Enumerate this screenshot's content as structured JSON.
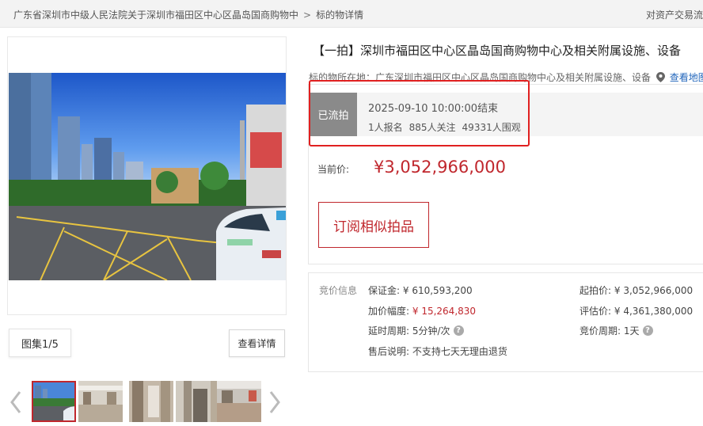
{
  "breadcrumb": {
    "item1": "广东省深圳市中级人民法院关于深圳市福田区中心区晶岛国商购物中",
    "separator": ">",
    "item2": "标的物详情"
  },
  "topbar_right": "对资产交易流",
  "gallery": {
    "counter_label": "图集1/5",
    "details_button": "查看详情",
    "thumb_count": 5
  },
  "title": "【一拍】深圳市福田区中心区晶岛国商购物中心及相关附属设施、设备",
  "location": {
    "label": "标的物所在地：",
    "value": "广东深圳市福田区中心区晶岛国商购物中心及相关附属设施、设备",
    "map_link": "查看地图"
  },
  "status": {
    "badge": "已流拍",
    "end_time": "2025-09-10 10:00:00结束",
    "registrations": "1人报名",
    "followers": "885人关注",
    "viewers": "49331人围观"
  },
  "price": {
    "label": "当前价:",
    "value": "¥3,052,966,000"
  },
  "subscribe_button": "订阅相似拍品",
  "bid_info": {
    "section_label": "竞价信息",
    "deposit_label": "保证金:",
    "deposit_value": "¥ 610,593,200",
    "increment_label": "加价幅度:",
    "increment_value": "¥ 15,264,830",
    "delay_label": "延时周期:",
    "delay_value": "5分钟/次",
    "after_sale_label": "售后说明:",
    "after_sale_value": "不支持七天无理由退货",
    "start_price_label": "起拍价:",
    "start_price_value": "¥ 3,052,966,000",
    "appraisal_label": "评估价:",
    "appraisal_value": "¥ 4,361,380,000",
    "bid_cycle_label": "竞价周期:",
    "bid_cycle_value": "1天"
  },
  "colors": {
    "accent_red": "#c0272d",
    "highlight_red": "#e02020",
    "status_gray": "#8a8a8a"
  },
  "icons": [
    "chevron-left-icon",
    "chevron-right-icon",
    "location-pin-icon",
    "help-icon"
  ]
}
